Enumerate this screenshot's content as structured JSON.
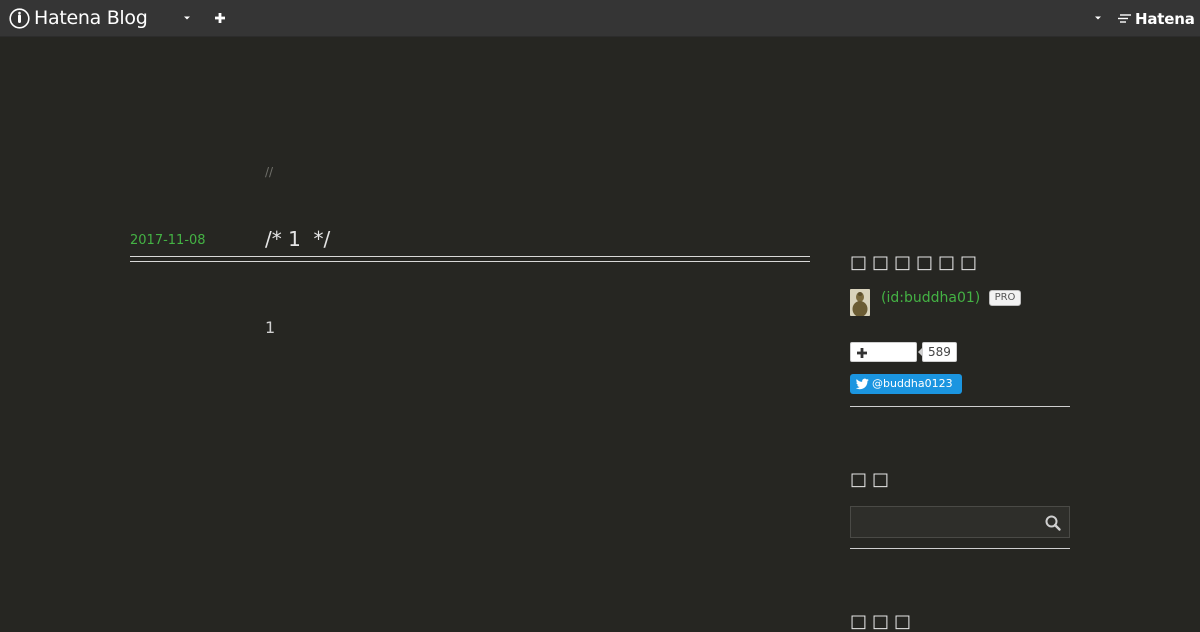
{
  "header": {
    "logo_text": "Hatena Blog",
    "hatena_text": "Hatena"
  },
  "entry": {
    "breadcrumb": "//",
    "date": "2017-11-08",
    "title": "/* 1  */",
    "body": "1"
  },
  "sidebar": {
    "profile": {
      "title": "□□□□□□",
      "user_id": "(id:buddha01)",
      "pro_label": "PRO",
      "subscribers": "589",
      "twitter_label": "@buddha0123"
    },
    "search": {
      "title": "□□",
      "placeholder": ""
    },
    "next_title": "□□□"
  },
  "colors": {
    "background": "#262622",
    "header": "#353535",
    "link_green": "#44b244",
    "twitter_blue": "#1b95e0"
  }
}
